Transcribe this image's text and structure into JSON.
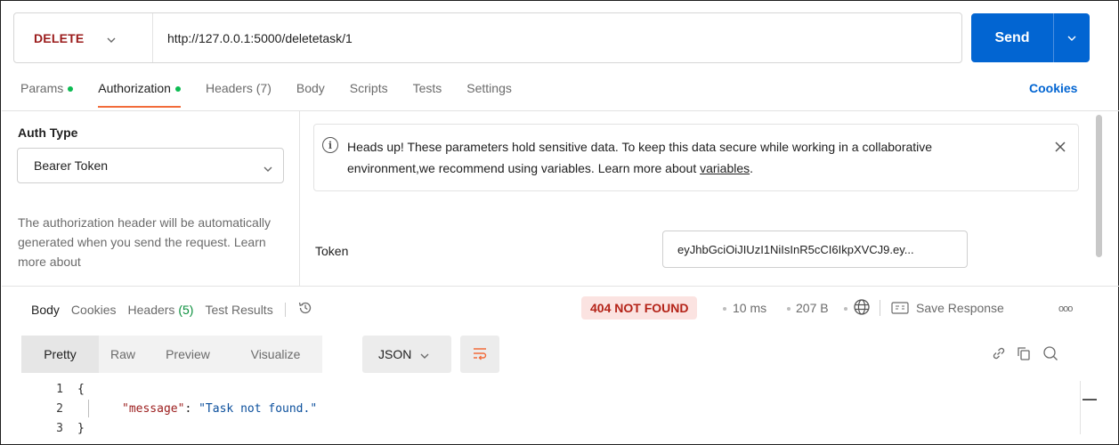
{
  "request": {
    "method": "DELETE",
    "url": "http://127.0.0.1:5000/deletetask/1",
    "send_label": "Send"
  },
  "request_tabs": [
    {
      "label": "Params",
      "dot": true
    },
    {
      "label": "Authorization",
      "dot": true,
      "active": true
    },
    {
      "label": "Headers (7)",
      "dot": false
    },
    {
      "label": "Body",
      "dot": false
    },
    {
      "label": "Scripts",
      "dot": false
    },
    {
      "label": "Tests",
      "dot": false
    },
    {
      "label": "Settings",
      "dot": false
    }
  ],
  "cookies_label": "Cookies",
  "auth": {
    "type_label": "Auth Type",
    "type_value": "Bearer Token",
    "description": "The authorization header will be automatically generated when you send the request. Learn more about",
    "notice_text": "Heads up! These parameters hold sensitive data. To keep this data secure while working in a collaborative environment,we recommend using variables. Learn more about ",
    "notice_link": "variables",
    "notice_end": ".",
    "token_label": "Token",
    "token_value": "eyJhbGciOiJIUzI1NiIsInR5cCI6IkpXVCJ9.ey..."
  },
  "response": {
    "tabs": {
      "body": "Body",
      "cookies": "Cookies",
      "headers": "Headers",
      "headers_count": "(5)",
      "test_results": "Test Results"
    },
    "status": "404 NOT FOUND",
    "time": "10 ms",
    "size": "207 B",
    "save_label": "Save Response",
    "more": "ooo"
  },
  "body_view": {
    "modes": [
      "Pretty",
      "Raw",
      "Preview",
      "Visualize"
    ],
    "active_mode": "Pretty",
    "format": "JSON"
  },
  "code": {
    "lines": [
      "1",
      "2",
      "3"
    ],
    "open": "{",
    "key": "\"message\"",
    "colon": ": ",
    "value": "\"Task not found.\"",
    "close": "}"
  },
  "colors": {
    "accent": "#0265d2",
    "method": "#9b1c1c",
    "status_bg": "#fbe3e1",
    "active_tab_underline": "#f26b3a",
    "dot": "#0cbb52"
  }
}
